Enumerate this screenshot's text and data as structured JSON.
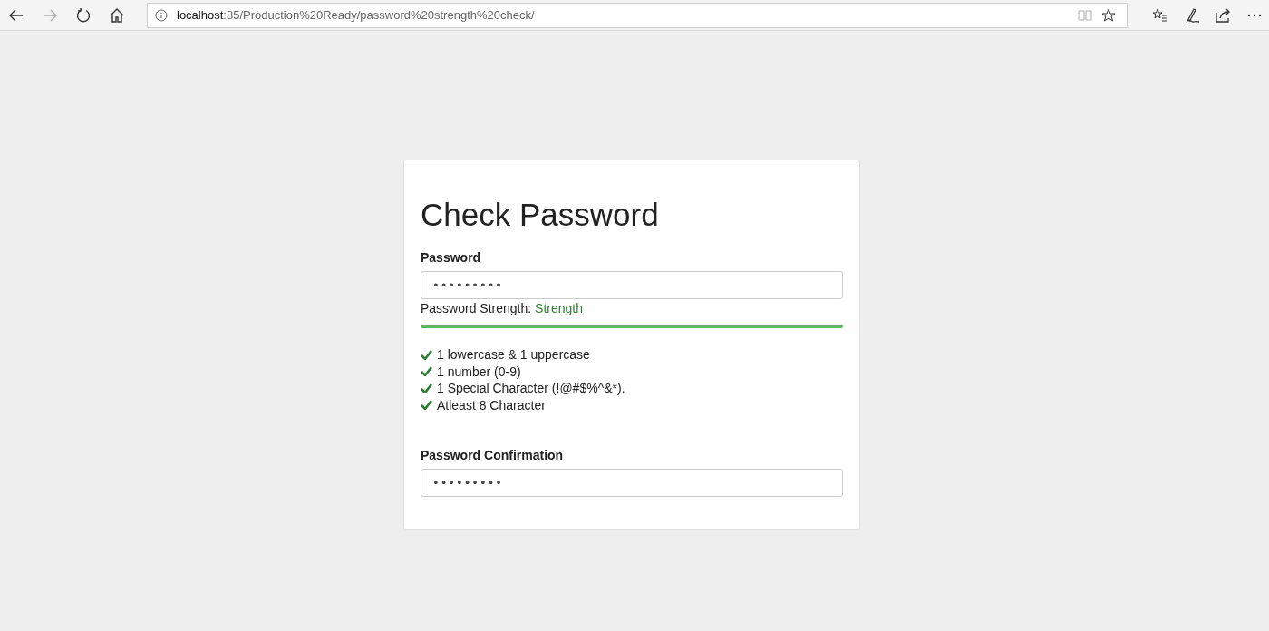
{
  "browser": {
    "nav": [
      {
        "kind": "back",
        "disabled": false
      },
      {
        "kind": "forward",
        "disabled": true
      },
      {
        "kind": "refresh",
        "disabled": false
      },
      {
        "kind": "home",
        "disabled": false
      }
    ],
    "address": {
      "host": "localhost",
      "path": ":85/Production%20Ready/password%20strength%20check/"
    },
    "favorited": false
  },
  "form": {
    "title": "Check Password",
    "password": {
      "label": "Password",
      "value": "•••••••••"
    },
    "strength": {
      "label": "Password Strength:",
      "value": "Strength",
      "level": 1
    },
    "rules": [
      {
        "text": "1 lowercase & 1 uppercase",
        "met": true
      },
      {
        "text": "1 number (0-9)",
        "met": true
      },
      {
        "text": "1 Special Character (!@#$%^&*).",
        "met": true
      },
      {
        "text": "Atleast 8 Character",
        "met": true
      }
    ],
    "confirmation": {
      "label": "Password Confirmation",
      "value": "•••••••••"
    }
  }
}
